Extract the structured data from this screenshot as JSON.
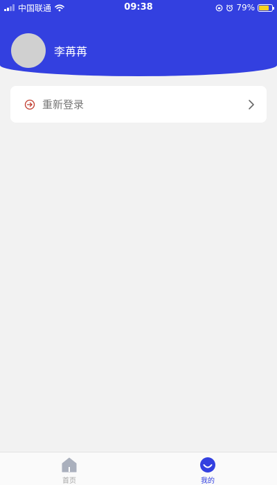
{
  "status_bar": {
    "carrier": "中国联通",
    "time": "09:38",
    "battery_percent": "79%",
    "battery_level": 0.79
  },
  "profile": {
    "name": "李苒苒"
  },
  "menu": {
    "relogin_label": "重新登录"
  },
  "tabbar": {
    "tabs": [
      {
        "label": "首页",
        "active": false
      },
      {
        "label": "我的",
        "active": true
      }
    ]
  },
  "colors": {
    "primary": "#3340e0",
    "relogin_icon": "#c0392b",
    "tab_inactive": "#a7a7a7",
    "background": "#f2f2f2"
  }
}
